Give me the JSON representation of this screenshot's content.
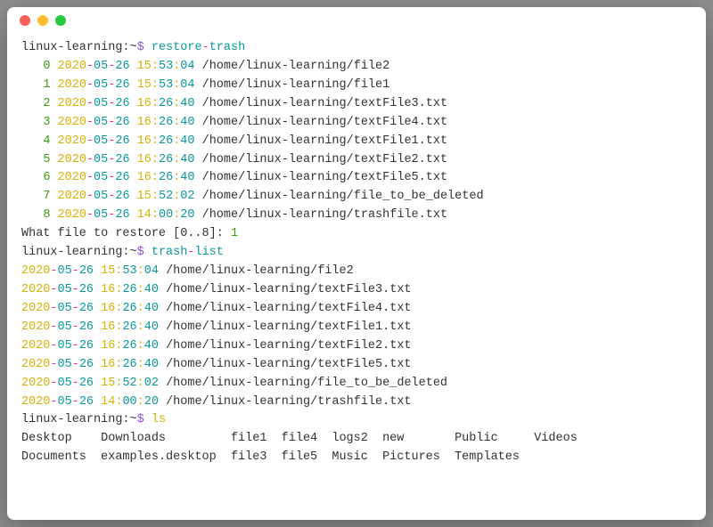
{
  "prompt": {
    "host": "linux-learning",
    "cwd": "~",
    "dollar": "$"
  },
  "commands": {
    "restore_trash_1": "restore",
    "restore_trash_dash": "-",
    "restore_trash_2": "trash",
    "trash_list_1": "trash",
    "trash_list_dash": "-",
    "trash_list_2": "list",
    "ls": "ls"
  },
  "restore_items": [
    {
      "idx": "0",
      "year": "2020",
      "d1": "-",
      "month": "05",
      "d2": "-",
      "day": "26",
      "h": "15",
      "c1": ":",
      "m": "53",
      "c2": ":",
      "s": "04",
      "path": "/home/linux-learning/file2"
    },
    {
      "idx": "1",
      "year": "2020",
      "d1": "-",
      "month": "05",
      "d2": "-",
      "day": "26",
      "h": "15",
      "c1": ":",
      "m": "53",
      "c2": ":",
      "s": "04",
      "path": "/home/linux-learning/file1"
    },
    {
      "idx": "2",
      "year": "2020",
      "d1": "-",
      "month": "05",
      "d2": "-",
      "day": "26",
      "h": "16",
      "c1": ":",
      "m": "26",
      "c2": ":",
      "s": "40",
      "path": "/home/linux-learning/textFile3.txt"
    },
    {
      "idx": "3",
      "year": "2020",
      "d1": "-",
      "month": "05",
      "d2": "-",
      "day": "26",
      "h": "16",
      "c1": ":",
      "m": "26",
      "c2": ":",
      "s": "40",
      "path": "/home/linux-learning/textFile4.txt"
    },
    {
      "idx": "4",
      "year": "2020",
      "d1": "-",
      "month": "05",
      "d2": "-",
      "day": "26",
      "h": "16",
      "c1": ":",
      "m": "26",
      "c2": ":",
      "s": "40",
      "path": "/home/linux-learning/textFile1.txt"
    },
    {
      "idx": "5",
      "year": "2020",
      "d1": "-",
      "month": "05",
      "d2": "-",
      "day": "26",
      "h": "16",
      "c1": ":",
      "m": "26",
      "c2": ":",
      "s": "40",
      "path": "/home/linux-learning/textFile2.txt"
    },
    {
      "idx": "6",
      "year": "2020",
      "d1": "-",
      "month": "05",
      "d2": "-",
      "day": "26",
      "h": "16",
      "c1": ":",
      "m": "26",
      "c2": ":",
      "s": "40",
      "path": "/home/linux-learning/textFile5.txt"
    },
    {
      "idx": "7",
      "year": "2020",
      "d1": "-",
      "month": "05",
      "d2": "-",
      "day": "26",
      "h": "15",
      "c1": ":",
      "m": "52",
      "c2": ":",
      "s": "02",
      "path": "/home/linux-learning/file_to_be_deleted"
    },
    {
      "idx": "8",
      "year": "2020",
      "d1": "-",
      "month": "05",
      "d2": "-",
      "day": "26",
      "h": "14",
      "c1": ":",
      "m": "00",
      "c2": ":",
      "s": "20",
      "path": "/home/linux-learning/trashfile.txt"
    }
  ],
  "restore_prompt": {
    "text": "What file to restore [0..8]: ",
    "input": "1"
  },
  "trash_list": [
    {
      "year": "2020",
      "d1": "-",
      "month": "05",
      "d2": "-",
      "day": "26",
      "h": "15",
      "c1": ":",
      "m": "53",
      "c2": ":",
      "s": "04",
      "path": "/home/linux-learning/file2"
    },
    {
      "year": "2020",
      "d1": "-",
      "month": "05",
      "d2": "-",
      "day": "26",
      "h": "16",
      "c1": ":",
      "m": "26",
      "c2": ":",
      "s": "40",
      "path": "/home/linux-learning/textFile3.txt"
    },
    {
      "year": "2020",
      "d1": "-",
      "month": "05",
      "d2": "-",
      "day": "26",
      "h": "16",
      "c1": ":",
      "m": "26",
      "c2": ":",
      "s": "40",
      "path": "/home/linux-learning/textFile4.txt"
    },
    {
      "year": "2020",
      "d1": "-",
      "month": "05",
      "d2": "-",
      "day": "26",
      "h": "16",
      "c1": ":",
      "m": "26",
      "c2": ":",
      "s": "40",
      "path": "/home/linux-learning/textFile1.txt"
    },
    {
      "year": "2020",
      "d1": "-",
      "month": "05",
      "d2": "-",
      "day": "26",
      "h": "16",
      "c1": ":",
      "m": "26",
      "c2": ":",
      "s": "40",
      "path": "/home/linux-learning/textFile2.txt"
    },
    {
      "year": "2020",
      "d1": "-",
      "month": "05",
      "d2": "-",
      "day": "26",
      "h": "16",
      "c1": ":",
      "m": "26",
      "c2": ":",
      "s": "40",
      "path": "/home/linux-learning/textFile5.txt"
    },
    {
      "year": "2020",
      "d1": "-",
      "month": "05",
      "d2": "-",
      "day": "26",
      "h": "15",
      "c1": ":",
      "m": "52",
      "c2": ":",
      "s": "02",
      "path": "/home/linux-learning/file_to_be_deleted"
    },
    {
      "year": "2020",
      "d1": "-",
      "month": "05",
      "d2": "-",
      "day": "26",
      "h": "14",
      "c1": ":",
      "m": "00",
      "c2": ":",
      "s": "20",
      "path": "/home/linux-learning/trashfile.txt"
    }
  ],
  "ls_output": {
    "row1": "Desktop    Downloads         file1  file4  logs2  new       Public     Videos",
    "row2": "Documents  examples.desktop  file3  file5  Music  Pictures  Templates"
  }
}
